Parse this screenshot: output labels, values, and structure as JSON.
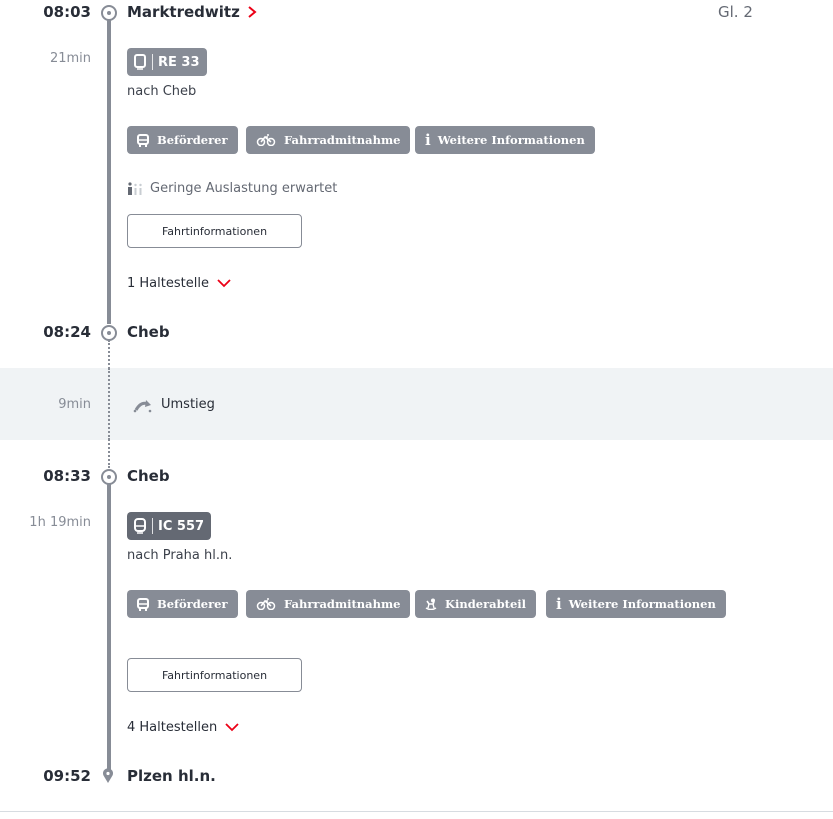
{
  "colors": {
    "accent_red": "#ec0016",
    "line_gray": "#878c96",
    "badge_re": "#878c96",
    "badge_ic": "#646973",
    "transfer_bg": "#f0f3f5"
  },
  "stops": [
    {
      "time": "08:03",
      "station": "Marktredwitz",
      "platform": "Gl. 2",
      "has_link": true
    },
    {
      "time": "08:24",
      "station": "Cheb"
    },
    {
      "time": "08:33",
      "station": "Cheb"
    },
    {
      "time": "09:52",
      "station": "Plzen hl.n."
    }
  ],
  "legs": [
    {
      "duration": "21min",
      "train_icon": "train-icon",
      "train": "RE 33",
      "destination": "nach Cheb",
      "chips": [
        {
          "icon": "bus-icon",
          "label": "Beförderer"
        },
        {
          "icon": "bicycle-icon",
          "label": "Fahrradmitnahme"
        },
        {
          "icon": "info-icon",
          "label": "Weitere Informationen"
        }
      ],
      "occupancy": "Geringe Auslastung erwartet",
      "info_button": "Fahrtinformationen",
      "stops_toggle": "1 Haltestelle"
    },
    {
      "duration": "1h 19min",
      "train_icon": "ic-train-icon",
      "train": "IC 557",
      "destination": "nach Praha hl.n.",
      "chips": [
        {
          "icon": "bus-icon",
          "label": "Beförderer"
        },
        {
          "icon": "bicycle-icon",
          "label": "Fahrradmitnahme"
        },
        {
          "icon": "rocking-horse-icon",
          "label": "Kinderabteil"
        },
        {
          "icon": "info-icon",
          "label": "Weitere Informationen"
        }
      ],
      "info_button": "Fahrtinformationen",
      "stops_toggle": "4 Haltestellen"
    }
  ],
  "transfer": {
    "duration": "9min",
    "label": "Umstieg",
    "icon": "transfer-icon"
  }
}
